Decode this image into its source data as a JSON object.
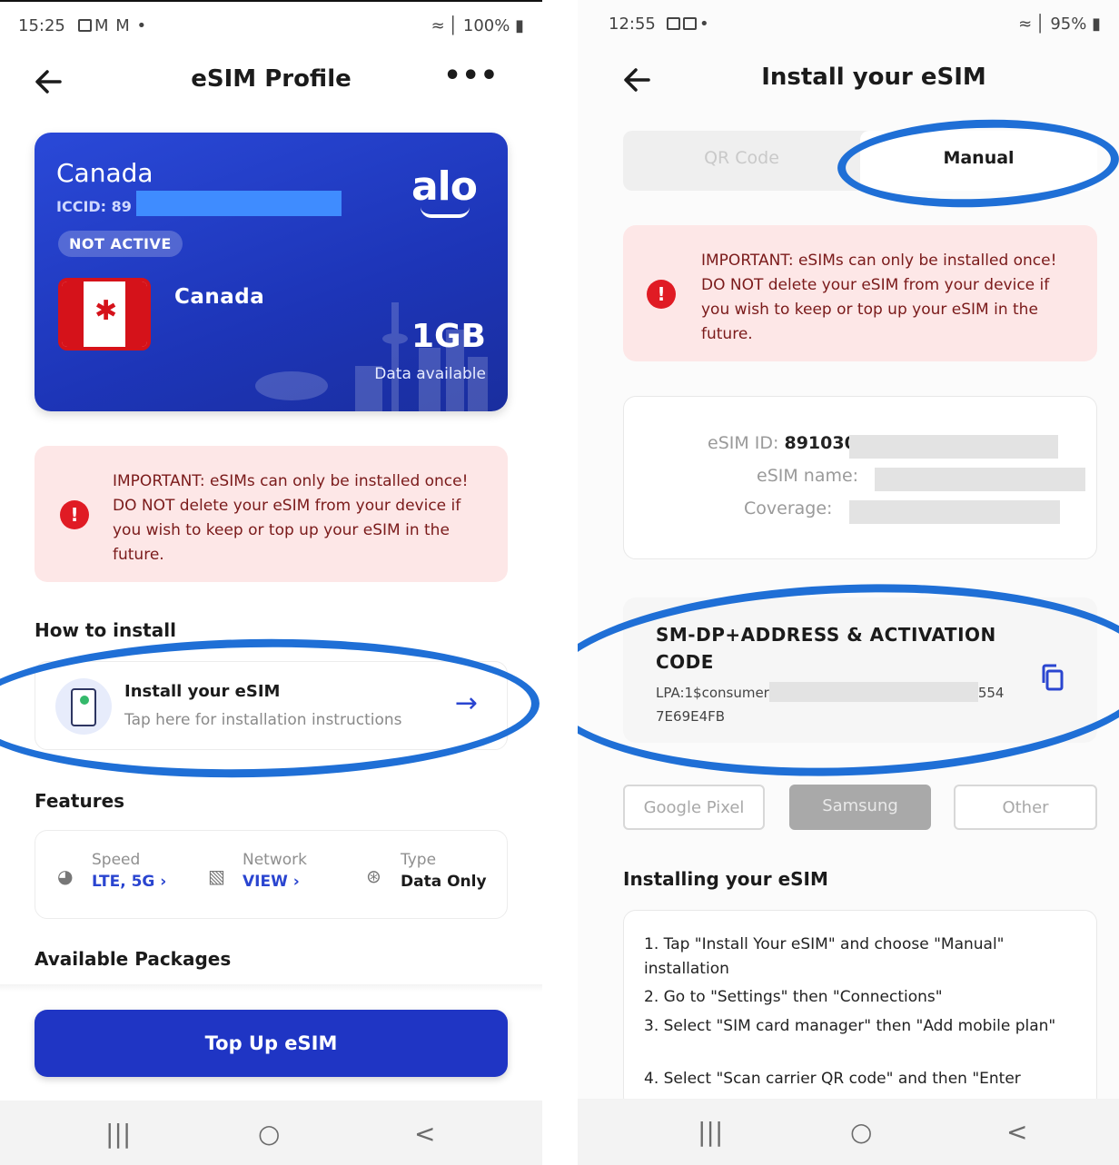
{
  "left": {
    "status": {
      "time": "15:25",
      "extra": "M M •",
      "right": "100%"
    },
    "title": "eSIM Profile",
    "card": {
      "country": "Canada",
      "iccid": "ICCID: 89",
      "brand": "alo",
      "status": "NOT ACTIVE",
      "plan": "Canada",
      "data": "1GB",
      "data_label": "Data available"
    },
    "alert": "IMPORTANT: eSIMs can only be installed once! DO NOT delete your eSIM from your device if you wish to keep or top up your eSIM in the future.",
    "how_to_install": "How to install",
    "install": {
      "title": "Install your eSIM",
      "subtitle": "Tap here for installation instructions"
    },
    "features_label": "Features",
    "features": [
      {
        "label": "Speed",
        "value": "LTE, 5G ›"
      },
      {
        "label": "Network",
        "value": "VIEW ›"
      },
      {
        "label": "Type",
        "value": "Data Only"
      }
    ],
    "packages_label": "Available Packages",
    "cta": "Top Up eSIM"
  },
  "right": {
    "status": {
      "time": "12:55",
      "extra": "•",
      "right": "95%"
    },
    "title": "Install your eSIM",
    "tabs": [
      "QR Code",
      "Manual"
    ],
    "alert": "IMPORTANT: eSIMs can only be installed once! DO NOT delete your eSIM from your device if you wish to keep or top up your eSIM in the future.",
    "esim_id_label": "eSIM ID:",
    "esim_id_value": "891030",
    "esim_name_label": "eSIM name:",
    "coverage_label": "Coverage:",
    "code_title": "SM-DP+ADDRESS & ACTIVATION CODE",
    "code_prefix": "LPA:1$consumer",
    "code_suffix": "554",
    "code_line2": "7E69E4FB",
    "devices": [
      "Google Pixel",
      "Samsung",
      "Other"
    ],
    "installing_label": "Installing your eSIM",
    "steps": [
      "1. Tap \"Install Your eSIM\" and choose \"Manual\" installation",
      "2. Go to \"Settings\" then \"Connections\"",
      "3. Select \"SIM card manager\" then \"Add mobile plan\"",
      "4. Select \"Scan carrier QR code\" and then \"Enter"
    ]
  },
  "nav": {
    "recent": "|||",
    "home": "○",
    "back": "<"
  },
  "colors": {
    "primary": "#1f35c4",
    "annotation": "#1f6fd6",
    "alert_bg": "#fde7e7",
    "alert_icon": "#e01b24"
  }
}
